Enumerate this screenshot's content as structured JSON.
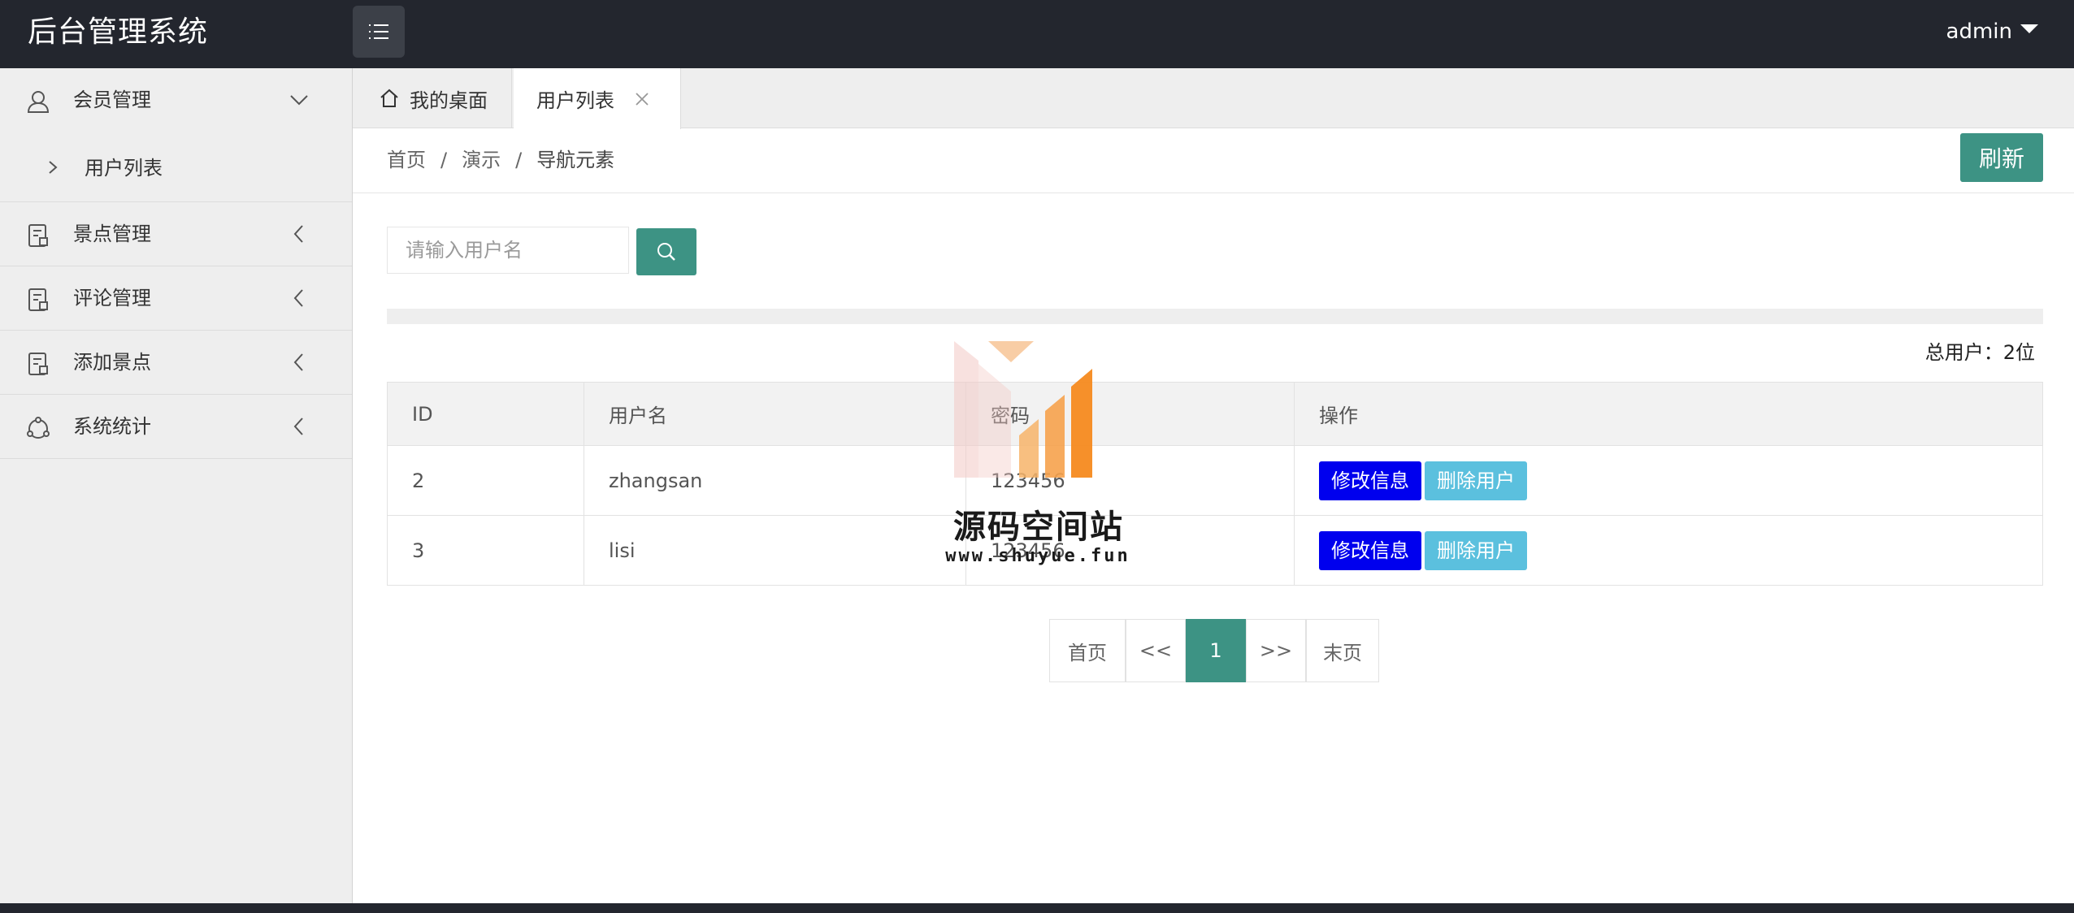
{
  "header": {
    "app_title": "后台管理系统",
    "user_name": "admin"
  },
  "sidebar": {
    "groups": [
      {
        "label": "会员管理",
        "icon": "user-icon",
        "expanded": true,
        "children": [
          {
            "label": "用户列表"
          }
        ]
      },
      {
        "label": "景点管理",
        "icon": "document-icon",
        "expanded": false
      },
      {
        "label": "评论管理",
        "icon": "document-icon",
        "expanded": false
      },
      {
        "label": "添加景点",
        "icon": "document-icon",
        "expanded": false
      },
      {
        "label": "系统统计",
        "icon": "chart-circle-icon",
        "expanded": false
      }
    ]
  },
  "tabs": [
    {
      "label": "我的桌面",
      "icon": "home-icon",
      "active": false
    },
    {
      "label": "用户列表",
      "active": true,
      "closable": true
    }
  ],
  "breadcrumb": {
    "items": [
      "首页",
      "演示",
      "导航元素"
    ],
    "separator": "/"
  },
  "refresh_label": "刷新",
  "search": {
    "placeholder": "请输入用户名",
    "button_icon": "search-icon"
  },
  "total": {
    "label": "总用户：",
    "value": "2位"
  },
  "table": {
    "headers": [
      "ID",
      "用户名",
      "密码",
      "操作"
    ],
    "rows": [
      {
        "id": "2",
        "username": "zhangsan",
        "password": "123456"
      },
      {
        "id": "3",
        "username": "lisi",
        "password": "123456"
      }
    ],
    "edit_label": "修改信息",
    "delete_label": "删除用户"
  },
  "pagination": {
    "first": "首页",
    "prev": "<<",
    "current": "1",
    "next": ">>",
    "last": "末页"
  },
  "watermark": {
    "title": "源码空间站",
    "url": "www.shuyue.fun"
  },
  "colors": {
    "topbar": "#23262e",
    "accent": "#3d9384",
    "edit_button": "#0000ee",
    "delete_button": "#5bc0de"
  }
}
